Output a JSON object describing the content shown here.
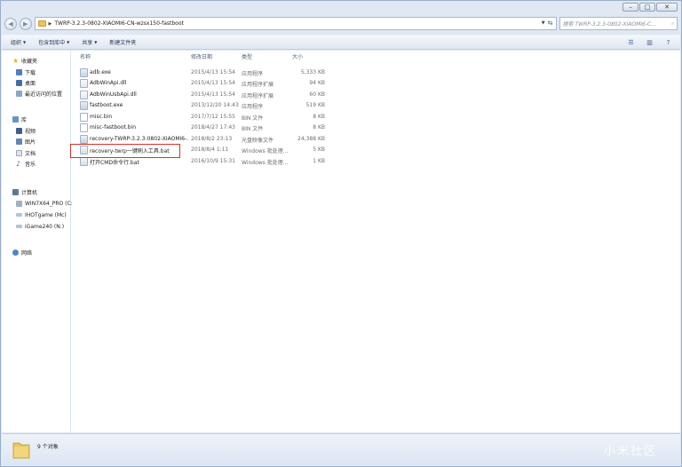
{
  "window": {
    "minimize_glyph": "–",
    "maximize_glyph": "□",
    "close_glyph": "✕"
  },
  "address": {
    "path": "TWRP-3.2.3-0802-XIAOMI6-CN-wzsx150-fastboot",
    "search_placeholder": "搜索 TWRP-3.2.3-0802-XIAOMI6-C..."
  },
  "toolbar": {
    "organize": "组织",
    "include_in_library": "包含到库中",
    "share": "共享",
    "new_folder": "新建文件夹"
  },
  "nav": {
    "favorites": {
      "label": "收藏夹",
      "items": [
        "下载",
        "桌面",
        "最近访问的位置"
      ]
    },
    "libraries": {
      "label": "库",
      "items": [
        "视频",
        "图片",
        "文档",
        "音乐"
      ]
    },
    "computer": {
      "label": "计算机",
      "items": [
        "WIN7X64_PRO (C:",
        "IHOTgame (Mc)",
        "iGame240 (N:)"
      ]
    },
    "network": {
      "label": "网络"
    }
  },
  "columns": {
    "name": "名称",
    "modified": "修改日期",
    "type": "类型",
    "size": "大小"
  },
  "files": [
    {
      "name": "adb.exe",
      "modified": "2015/4/13 15:54",
      "type": "应用程序",
      "size": "5,333 KB",
      "icon": "exe-icon"
    },
    {
      "name": "AdbWinApi.dll",
      "modified": "2015/4/13 15:54",
      "type": "应用程序扩展",
      "size": "94 KB",
      "icon": "dll-icon"
    },
    {
      "name": "AdbWinUsbApi.dll",
      "modified": "2015/4/13 15:54",
      "type": "应用程序扩展",
      "size": "60 KB",
      "icon": "dll-icon"
    },
    {
      "name": "fastboot.exe",
      "modified": "2013/12/20 14:43",
      "type": "应用程序",
      "size": "519 KB",
      "icon": "exe-icon"
    },
    {
      "name": "misc.bin",
      "modified": "2017/7/12 15:55",
      "type": "BIN 文件",
      "size": "8 KB",
      "icon": "bin-icon"
    },
    {
      "name": "misc-fastboot.bin",
      "modified": "2018/4/27 17:43",
      "type": "BIN 文件",
      "size": "8 KB",
      "icon": "bin-icon"
    },
    {
      "name": "recovery-TWRP-3.2.3-0802-XIAOMI6-...",
      "modified": "2018/8/2 23:13",
      "type": "光盘映像文件",
      "size": "24,388 KB",
      "icon": "disc-image-icon"
    },
    {
      "name": "recovery-twrp一键刷入工具.bat",
      "modified": "2018/8/4 1:11",
      "type": "Windows 批处理...",
      "size": "5 KB",
      "icon": "batch-file-icon"
    },
    {
      "name": "打开CMD命令行.bat",
      "modified": "2016/10/9 15:31",
      "type": "Windows 批处理...",
      "size": "1 KB",
      "icon": "batch-file-icon"
    }
  ],
  "status": {
    "item_count": "9 个对象"
  },
  "watermark": "小米社区",
  "colors": {
    "highlight_border": "#d9312c",
    "chrome": "#dfe8f3",
    "folder": "#e8c560"
  }
}
